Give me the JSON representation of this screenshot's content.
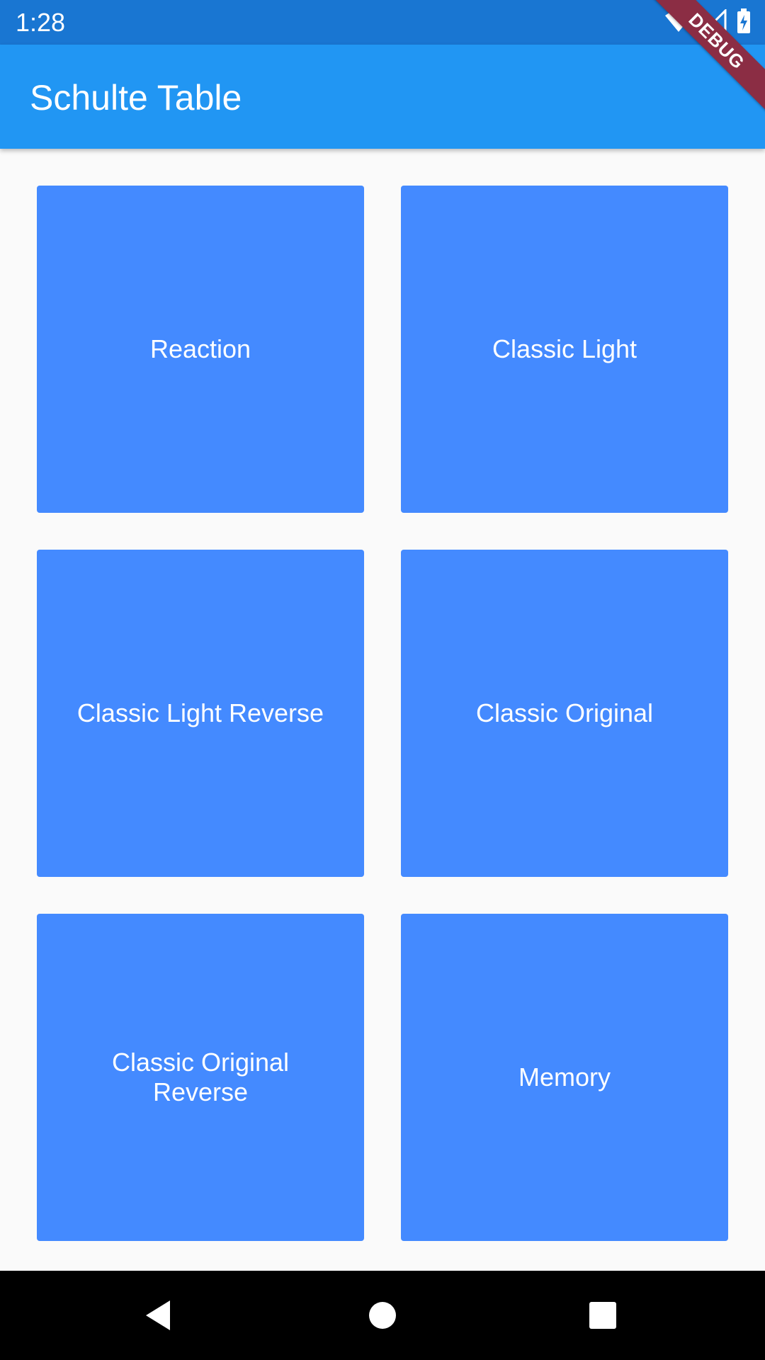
{
  "status_bar": {
    "time": "1:28",
    "icons": [
      "wifi-icon",
      "cell-signal-icon",
      "battery-charging-icon"
    ]
  },
  "app_bar": {
    "title": "Schulte Table",
    "debug_label": "DEBUG"
  },
  "tiles": [
    {
      "label": "Reaction"
    },
    {
      "label": "Classic Light"
    },
    {
      "label": "Classic Light Reverse"
    },
    {
      "label": "Classic Original"
    },
    {
      "label": "Classic Original Reverse"
    },
    {
      "label": "Memory"
    }
  ],
  "nav_bar": {
    "buttons": [
      "back-icon",
      "home-icon",
      "recents-icon"
    ]
  },
  "colors": {
    "status_bar": "#1976d2",
    "app_bar": "#2196f3",
    "tile": "#448aff",
    "background": "#fafafa",
    "debug_banner": "#8b2d44"
  }
}
